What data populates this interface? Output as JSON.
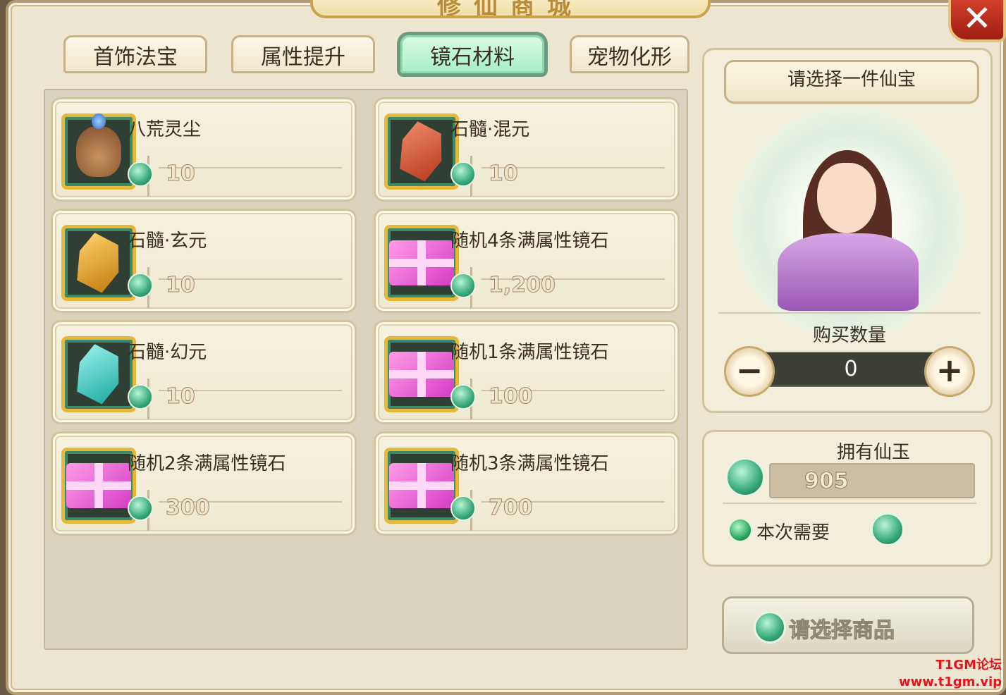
{
  "window": {
    "title": "修仙商城",
    "close_label": "✕"
  },
  "tabs": [
    {
      "label": "首饰法宝",
      "active": false
    },
    {
      "label": "属性提升",
      "active": false
    },
    {
      "label": "镜石材料",
      "active": true
    },
    {
      "label": "宠物化形",
      "active": false
    }
  ],
  "items": [
    {
      "name": "八荒灵尘",
      "price": "10",
      "icon": "bag-icon"
    },
    {
      "name": "石髓·混元",
      "price": "10",
      "icon": "red-stone-icon"
    },
    {
      "name": "石髓·玄元",
      "price": "10",
      "icon": "gold-stone-icon"
    },
    {
      "name": "随机4条满属性镜石",
      "price": "1,200",
      "icon": "gift-box-icon"
    },
    {
      "name": "石髓·幻元",
      "price": "10",
      "icon": "teal-stone-icon"
    },
    {
      "name": "随机1条满属性镜石",
      "price": "100",
      "icon": "gift-box-icon"
    },
    {
      "name": "随机2条满属性镜石",
      "price": "300",
      "icon": "gift-box-icon"
    },
    {
      "name": "随机3条满属性镜石",
      "price": "700",
      "icon": "gift-box-icon"
    }
  ],
  "detail": {
    "select_prompt": "请选择一件仙宝",
    "quantity_label": "购买数量",
    "quantity_value": "0",
    "minus_label": "−",
    "plus_label": "+"
  },
  "wallet": {
    "owned_label": "拥有仙玉",
    "owned_value": "905",
    "need_label": "本次需要"
  },
  "buy_button": {
    "label": "请选择商品"
  },
  "watermark": {
    "line1": "T1GM论坛",
    "line2": "www.t1gm.vip"
  },
  "colors": {
    "active_tab": "#a9efc8",
    "close_button": "#c8341f",
    "jade": "#36a879"
  }
}
